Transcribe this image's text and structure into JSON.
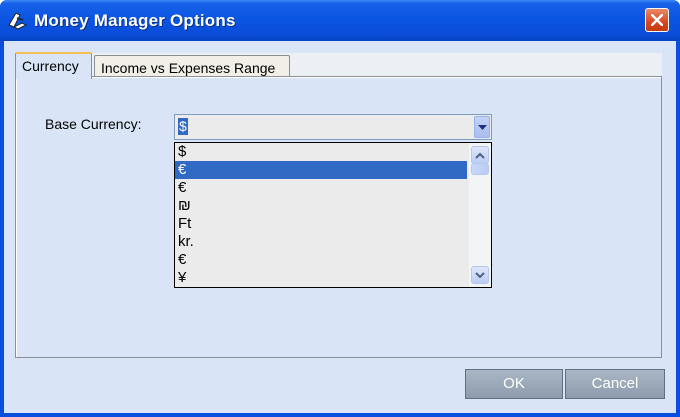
{
  "window": {
    "title": "Money Manager Options"
  },
  "tabs": [
    {
      "label": "Currency"
    },
    {
      "label": "Income vs Expenses Range"
    }
  ],
  "currency": {
    "label": "Base Currency:",
    "selected_value": "$",
    "options": [
      "$",
      "€",
      "€",
      "₪",
      "Ft",
      "kr.",
      "€",
      "¥"
    ],
    "highlighted_index": 1
  },
  "buttons": {
    "ok": "OK",
    "cancel": "Cancel"
  },
  "colors": {
    "titlebar": "#0b55e3",
    "client": "#d9e5f7",
    "selection": "#316ac5",
    "close": "#d9471f"
  },
  "icons": {
    "app": "money-manager-icon",
    "close": "close-icon",
    "dropdown": "chevron-down-icon",
    "scroll_up": "arrow-up-icon",
    "scroll_down": "arrow-down-icon"
  }
}
